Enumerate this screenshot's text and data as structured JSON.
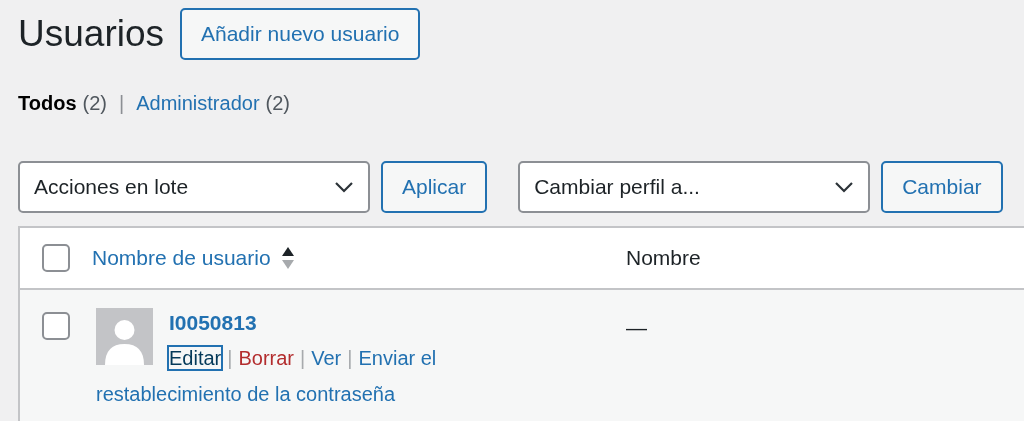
{
  "page_title": "Usuarios",
  "add_button": "Añadir nuevo usuario",
  "views": [
    {
      "label": "Todos",
      "count": "(2)",
      "selected": true
    },
    {
      "separator": "|",
      "label": "Administrador",
      "count": "(2)",
      "selected": false
    }
  ],
  "bulk_actions": {
    "select": "Acciones en lote",
    "button": "Aplicar"
  },
  "change_role": {
    "select": "Cambiar perfil a...",
    "button": "Cambiar"
  },
  "table": {
    "select_all_checked": false,
    "columns": [
      {
        "label": "Nombre de usuario",
        "sortable": true
      },
      {
        "label": "Nombre",
        "sortable": false
      }
    ],
    "rows": [
      {
        "checked": false,
        "username": "I0050813",
        "name": "—",
        "actions": [
          {
            "label": "Editar",
            "kind": "normal",
            "focused": true
          },
          {
            "separator": "|",
            "label": "Borrar",
            "kind": "danger",
            "focused": false
          },
          {
            "separator": "|",
            "label": "Ver",
            "kind": "normal",
            "focused": false
          },
          {
            "separator": "|",
            "label": "Enviar el restablecimiento de la contraseña",
            "kind": "normal",
            "focused": false
          }
        ]
      }
    ]
  }
}
